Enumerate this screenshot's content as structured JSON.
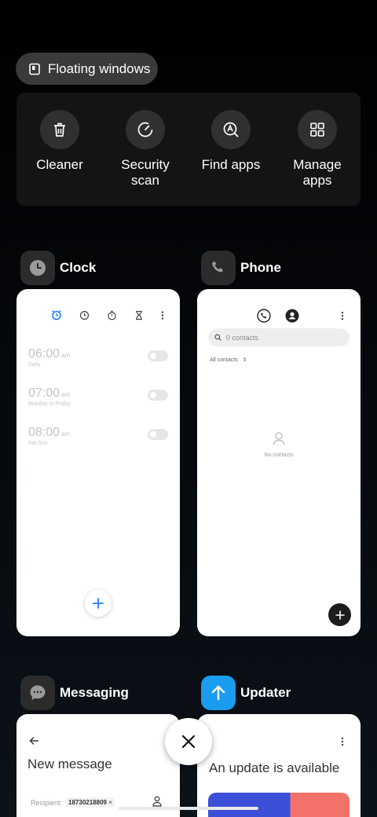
{
  "floating": {
    "label": "Floating windows"
  },
  "quick_actions": [
    {
      "label": "Cleaner",
      "icon": "trash-icon"
    },
    {
      "label": "Security\nscan",
      "icon": "security-scan-icon"
    },
    {
      "label": "Find apps",
      "icon": "find-apps-icon"
    },
    {
      "label": "Manage\napps",
      "icon": "grid-icon"
    }
  ],
  "apps": {
    "clock": {
      "name": "Clock",
      "alarms": [
        {
          "time": "06:00",
          "ampm": "am",
          "repeat": "Daily"
        },
        {
          "time": "07:00",
          "ampm": "am",
          "repeat": "Monday to Friday"
        },
        {
          "time": "08:00",
          "ampm": "am",
          "repeat": "Sat Sun"
        }
      ]
    },
    "phone": {
      "name": "Phone",
      "search_placeholder": "0 contacts",
      "filter_label": "All contacts",
      "empty_text": "No contacts"
    },
    "messaging": {
      "name": "Messaging",
      "title": "New message",
      "recipient_label": "Recipient:",
      "recipient_chip": "18730218809"
    },
    "updater": {
      "name": "Updater",
      "title": "An update is available"
    }
  },
  "colors": {
    "accent": "#1e7cf2",
    "updater_icon": "#1a9df0",
    "panel": "#141414"
  }
}
